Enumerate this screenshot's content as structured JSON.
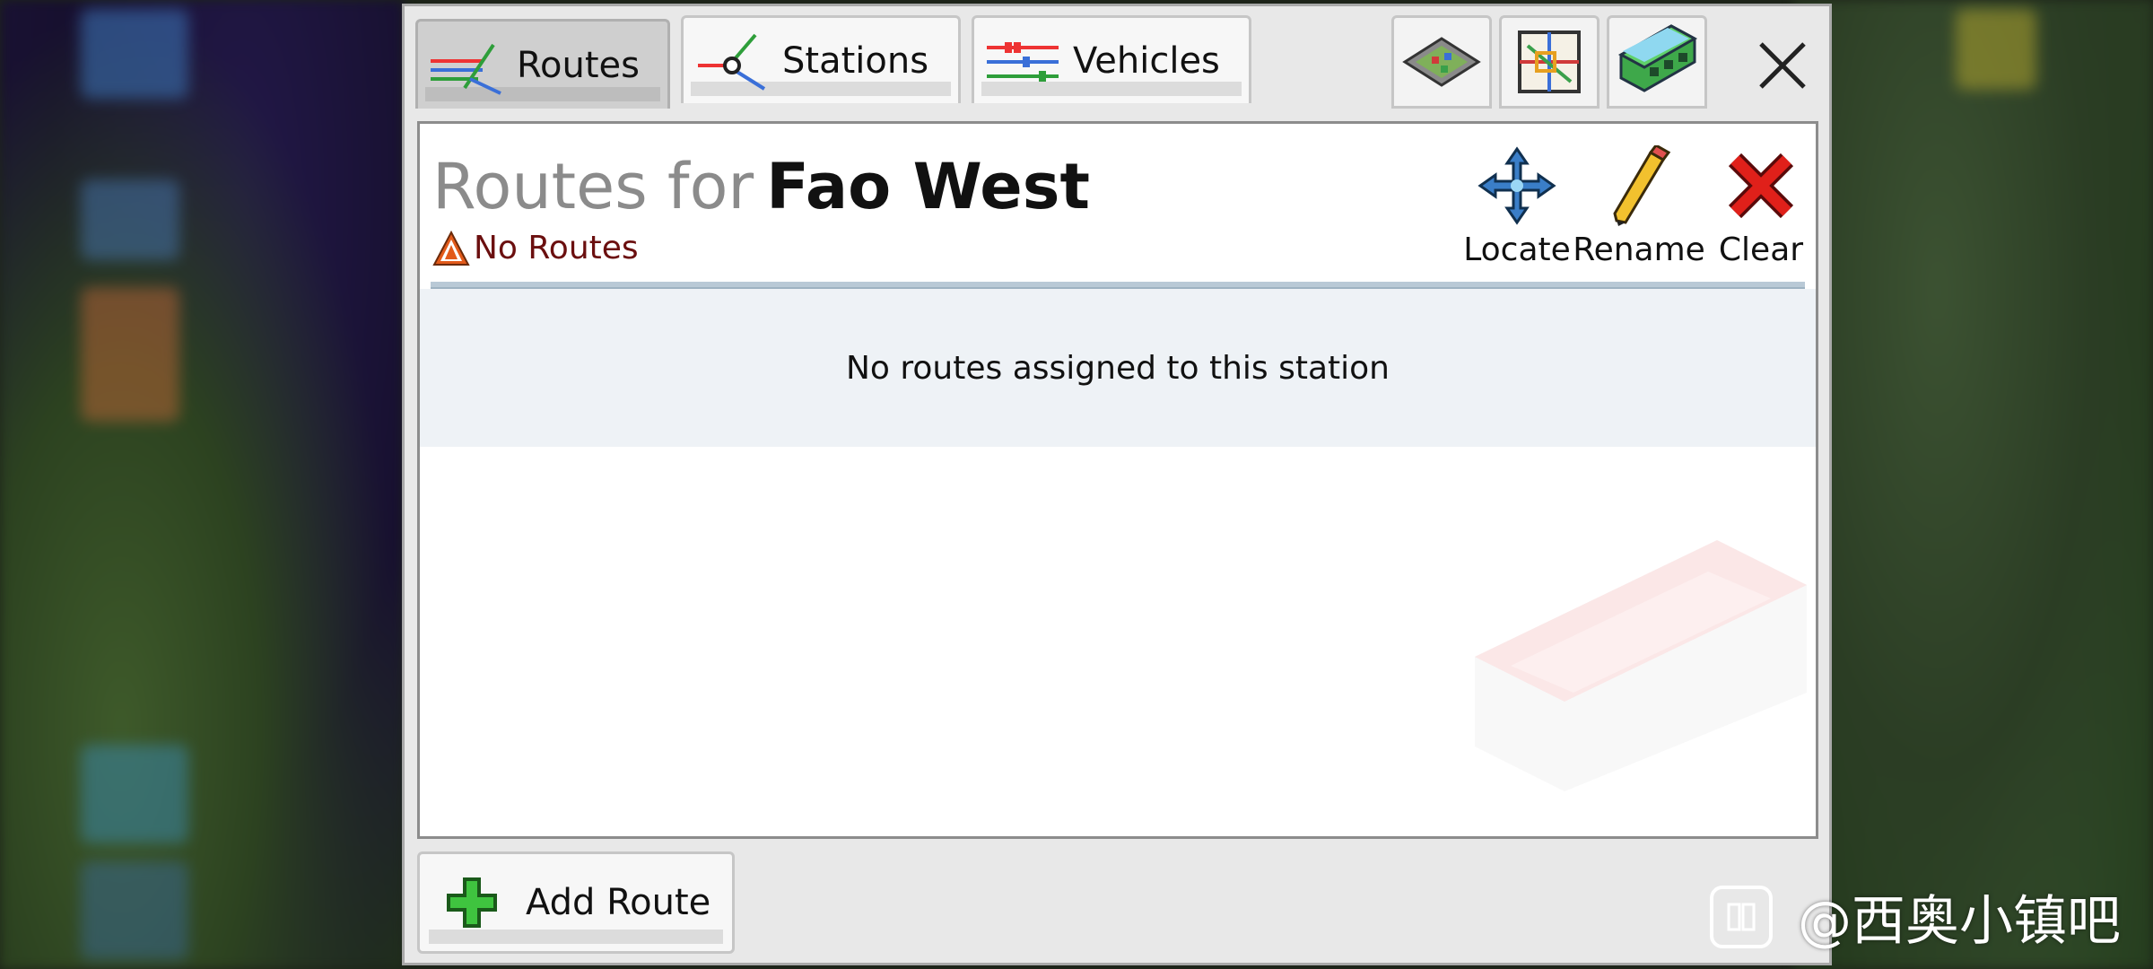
{
  "tabs": [
    {
      "label": "Routes",
      "icon": "routes-icon",
      "active": true
    },
    {
      "label": "Stations",
      "icon": "stations-icon",
      "active": false
    },
    {
      "label": "Vehicles",
      "icon": "vehicles-icon",
      "active": false
    }
  ],
  "toolbar_icons": [
    "map-icon",
    "network-map-icon",
    "train-icon",
    "close-icon"
  ],
  "header": {
    "title_prefix": "Routes for",
    "station_name": "Fao West",
    "warning_text": "No Routes"
  },
  "actions": {
    "locate_label": "Locate",
    "rename_label": "Rename",
    "clear_label": "Clear"
  },
  "content": {
    "empty_message": "No routes assigned to this station"
  },
  "footer": {
    "add_route_label": "Add Route"
  },
  "watermark": {
    "text": "@西奥小镇吧"
  },
  "colors": {
    "title_prefix": "#8b8b8b",
    "warning_text": "#6b0f0f",
    "empty_band": "#eef2f6",
    "divider": "#b9c9d6"
  }
}
